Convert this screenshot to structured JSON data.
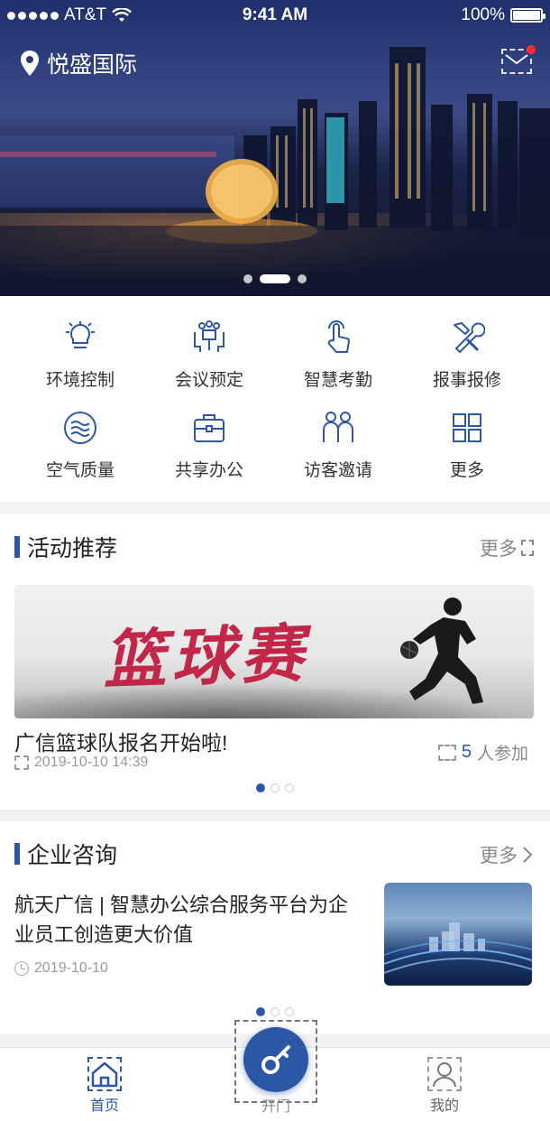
{
  "status_bar": {
    "carrier": "AT&T",
    "time": "9:41 AM",
    "battery": "100%"
  },
  "header": {
    "location": "悦盛国际"
  },
  "banner": {
    "slides": 3,
    "active_slide": 2
  },
  "services": [
    {
      "label": "环境控制",
      "icon": "bulb-icon"
    },
    {
      "label": "会议预定",
      "icon": "meeting-icon"
    },
    {
      "label": "智慧考勤",
      "icon": "touch-icon"
    },
    {
      "label": "报事报修",
      "icon": "tools-icon"
    },
    {
      "label": "空气质量",
      "icon": "air-icon"
    },
    {
      "label": "共享办公",
      "icon": "briefcase-icon"
    },
    {
      "label": "访客邀请",
      "icon": "visitors-icon"
    },
    {
      "label": "更多",
      "icon": "grid-icon"
    }
  ],
  "activities": {
    "title": "活动推荐",
    "more": "更多",
    "banner_text": "篮球赛",
    "item_title": "广信篮球队报名开始啦!",
    "item_time": "2019-10-10 14:39",
    "participants_count": "5",
    "participants_suffix": "人参加",
    "pages": 3,
    "active_page": 1
  },
  "news": {
    "title": "企业咨询",
    "more": "更多",
    "item_title": "航天广信 | 智慧办公综合服务平台为企业员工创造更大价值",
    "item_date": "2019-10-10",
    "pages": 3,
    "active_page": 1
  },
  "tabbar": {
    "home": "首页",
    "open_door": "开门",
    "mine": "我的"
  },
  "colors": {
    "accent": "#2c57a6",
    "badge": "#ff2b2b"
  }
}
